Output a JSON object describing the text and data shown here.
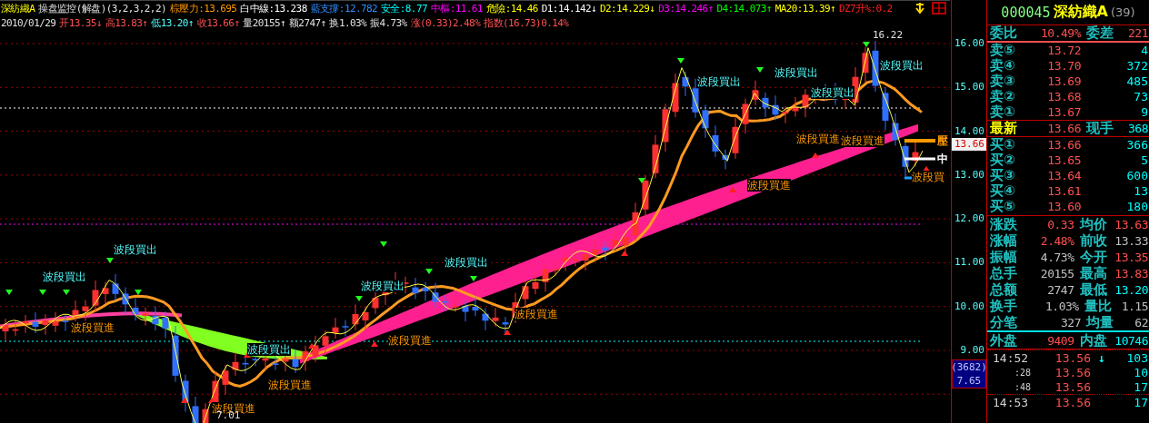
{
  "header": {
    "line_1": [
      {
        "text": "深紡織A",
        "color": "#ffff00"
      },
      {
        "text": "操盘监控(解盘)(3,2,3,2,2)",
        "color": "#e0e0e0"
      },
      {
        "text": "棕壓力:13.695",
        "color": "#ff9900"
      },
      {
        "text": "白中線:13.238",
        "color": "#ffffff"
      },
      {
        "text": "藍支撐:12.782",
        "color": "#2f8fff"
      },
      {
        "text": "安全:8.77",
        "color": "#00ffff"
      },
      {
        "text": "中樞:11.61",
        "color": "#ff00ff"
      },
      {
        "text": "危險:14.46",
        "color": "#ffff00"
      },
      {
        "text": "D1:14.142↓",
        "color": "#ffffff"
      },
      {
        "text": "D2:14.229↓",
        "color": "#ffff00"
      },
      {
        "text": "D3:14.246↑",
        "color": "#ff00ff"
      },
      {
        "text": "D4:14.073↑",
        "color": "#00ff00"
      },
      {
        "text": "MA20:13.39↑",
        "color": "#ffff00"
      },
      {
        "text": "DZ7升%:0.2",
        "color": "#ff2020"
      }
    ],
    "line_2": [
      {
        "text": "2010/01/29",
        "color": "#e0e0e0"
      },
      {
        "text": "开13.35↓",
        "color": "#ff5050"
      },
      {
        "text": "高13.83↑",
        "color": "#ff5050"
      },
      {
        "text": "低13.20↑",
        "color": "#54fcfc"
      },
      {
        "text": "收13.66↑",
        "color": "#ff5050"
      },
      {
        "text": "量20155↑",
        "color": "#e0e0e0"
      },
      {
        "text": "额2747↑",
        "color": "#e0e0e0"
      },
      {
        "text": "换1.03%",
        "color": "#e0e0e0"
      },
      {
        "text": "振4.73%",
        "color": "#e0e0e0"
      },
      {
        "text": "涨(0.33)2.48%",
        "color": "#ff5050"
      },
      {
        "text": "指数(16.73)0.14%",
        "color": "#ff5050"
      }
    ]
  },
  "chart": {
    "price_high": "16.22",
    "price_low": "7.01",
    "signals": [
      {
        "kind": "sell",
        "text": "波段買出"
      },
      {
        "kind": "sell",
        "text": "波段買出"
      },
      {
        "kind": "sell",
        "text": "波段買出"
      },
      {
        "kind": "sell",
        "text": "波段買出"
      },
      {
        "kind": "sell",
        "text": "波段買出"
      },
      {
        "kind": "sell",
        "text": "波段買出"
      },
      {
        "kind": "sell",
        "text": "波段買出"
      },
      {
        "kind": "sell",
        "text": "波段買出"
      },
      {
        "kind": "sell",
        "text": "波段買出"
      },
      {
        "kind": "buy",
        "text": "波段買進"
      },
      {
        "kind": "buy",
        "text": "波段買進"
      },
      {
        "kind": "buy",
        "text": "波段買進"
      },
      {
        "kind": "buy",
        "text": "波段買進"
      },
      {
        "kind": "buy",
        "text": "波段買進"
      },
      {
        "kind": "buy",
        "text": "波段買進"
      },
      {
        "kind": "buy",
        "text": "波段買進"
      },
      {
        "kind": "buy",
        "text": "波段買進"
      },
      {
        "kind": "buy",
        "text": "波段買"
      }
    ],
    "edge_marks": [
      {
        "text": "壓",
        "color": "#ff9900"
      },
      {
        "text": "中",
        "color": "#ffffff"
      }
    ]
  },
  "axis": {
    "ticks": [
      "16.00",
      "15.00",
      "14.00",
      "13.00",
      "12.00",
      "11.00",
      "10.00",
      "9.00"
    ],
    "current_price": "13.66",
    "volume_box": [
      "(3682)",
      "7.65"
    ]
  },
  "quote": {
    "code": "000045",
    "name": "深紡織A",
    "count": "(39)",
    "ratio": {
      "label": "委比",
      "value": "10.49%",
      "diff_label": "委差",
      "diff": "221"
    },
    "sells": [
      {
        "label": "卖⑤",
        "price": "13.72",
        "volume": "4"
      },
      {
        "label": "卖④",
        "price": "13.70",
        "volume": "372"
      },
      {
        "label": "卖③",
        "price": "13.69",
        "volume": "485"
      },
      {
        "label": "卖②",
        "price": "13.68",
        "volume": "73"
      },
      {
        "label": "卖①",
        "price": "13.67",
        "volume": "9"
      }
    ],
    "latest": {
      "label": "最新",
      "price": "13.66",
      "hand_label": "现手",
      "hand": "368"
    },
    "buys": [
      {
        "label": "买①",
        "price": "13.66",
        "volume": "366"
      },
      {
        "label": "买②",
        "price": "13.65",
        "volume": "5"
      },
      {
        "label": "买③",
        "price": "13.64",
        "volume": "600"
      },
      {
        "label": "买④",
        "price": "13.61",
        "volume": "13"
      },
      {
        "label": "买⑤",
        "price": "13.60",
        "volume": "180"
      }
    ],
    "stats": [
      {
        "left": {
          "label": "涨跌",
          "value": "0.33",
          "color": "#ff5050"
        },
        "right": {
          "label": "均价",
          "value": "13.63",
          "color": "#ff5050"
        }
      },
      {
        "left": {
          "label": "涨幅",
          "value": "2.48%",
          "color": "#ff5050"
        },
        "right": {
          "label": "前收",
          "value": "13.33",
          "color": "#c0c0c0"
        }
      },
      {
        "left": {
          "label": "振幅",
          "value": "4.73%",
          "color": "#c0c0c0"
        },
        "right": {
          "label": "今开",
          "value": "13.35",
          "color": "#ff5050"
        }
      },
      {
        "left": {
          "label": "总手",
          "value": "20155",
          "color": "#c0c0c0"
        },
        "right": {
          "label": "最高",
          "value": "13.83",
          "color": "#ff5050"
        }
      },
      {
        "left": {
          "label": "总额",
          "value": "2747",
          "color": "#c0c0c0"
        },
        "right": {
          "label": "最低",
          "value": "13.20",
          "color": "#00ffff"
        }
      },
      {
        "left": {
          "label": "换手",
          "value": "1.03%",
          "color": "#c0c0c0"
        },
        "right": {
          "label": "量比",
          "value": "1.15",
          "color": "#c0c0c0"
        }
      },
      {
        "left": {
          "label": "分笔",
          "value": "327",
          "color": "#c0c0c0"
        },
        "right": {
          "label": "均量",
          "value": "62",
          "color": "#c0c0c0"
        }
      }
    ],
    "outer": {
      "label": "外盘",
      "value": "9409",
      "label_2": "内盘",
      "value_2": "10746"
    },
    "ticks": [
      {
        "time": "14:52",
        "price": "13.56",
        "arrow": "↓",
        "volume": "103"
      },
      {
        "time": ":28",
        "price": "13.56",
        "volume": "10"
      },
      {
        "time": ":48",
        "price": "13.56",
        "volume": "17"
      },
      {
        "time": "14:53",
        "price": "13.56",
        "volume": "17"
      }
    ]
  }
}
